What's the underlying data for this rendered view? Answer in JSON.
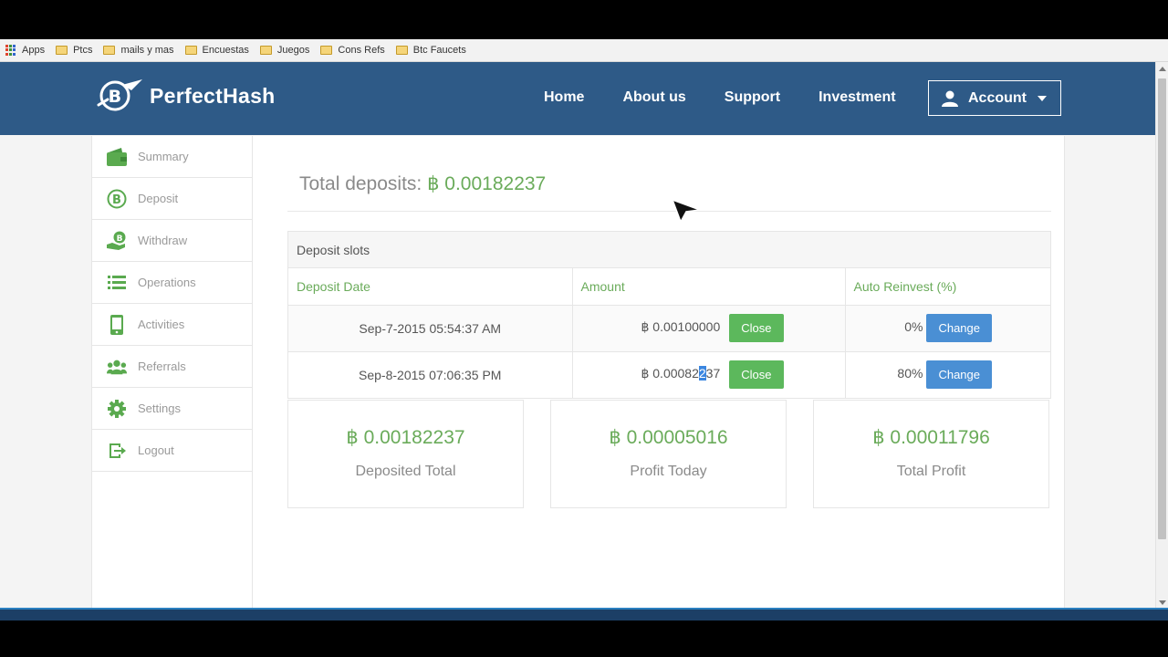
{
  "bookmarks": [
    {
      "label": "Apps",
      "icon": "apps-grid-icon"
    },
    {
      "label": "Ptcs",
      "icon": "folder-icon"
    },
    {
      "label": "mails y mas",
      "icon": "folder-icon"
    },
    {
      "label": "Encuestas",
      "icon": "folder-icon"
    },
    {
      "label": "Juegos",
      "icon": "folder-icon"
    },
    {
      "label": "Cons Refs",
      "icon": "folder-icon"
    },
    {
      "label": "Btc Faucets",
      "icon": "folder-icon"
    }
  ],
  "brand": {
    "name": "PerfectHash",
    "color": "#2e5a87"
  },
  "nav": {
    "home": "Home",
    "about": "About us",
    "support": "Support",
    "investment": "Investment",
    "account": "Account"
  },
  "sidebar": {
    "items": [
      {
        "label": "Summary",
        "icon": "wallet-icon"
      },
      {
        "label": "Deposit",
        "icon": "bitcoin-icon"
      },
      {
        "label": "Withdraw",
        "icon": "hand-coin-icon"
      },
      {
        "label": "Operations",
        "icon": "list-icon"
      },
      {
        "label": "Activities",
        "icon": "phone-icon"
      },
      {
        "label": "Referrals",
        "icon": "users-icon"
      },
      {
        "label": "Settings",
        "icon": "gear-icon"
      },
      {
        "label": "Logout",
        "icon": "logout-icon"
      }
    ]
  },
  "main": {
    "total_label": "Total deposits:",
    "total_value": "฿ 0.00182237",
    "slots_title": "Deposit slots",
    "columns": [
      "Deposit Date",
      "Amount",
      "Auto Reinvest (%)"
    ],
    "rows": [
      {
        "date": "Sep-7-2015 05:54:37 AM",
        "amount": "฿ 0.00100000",
        "close": "Close",
        "reinvest": "0%",
        "change": "Change"
      },
      {
        "date": "Sep-8-2015 07:06:35 PM",
        "amount_pre": "฿ 0.00082",
        "amount_sel": "2",
        "amount_post": "37",
        "close": "Close",
        "reinvest": "80%",
        "change": "Change"
      }
    ],
    "cards": [
      {
        "value": "฿ 0.00182237",
        "label": "Deposited Total"
      },
      {
        "value": "฿ 0.00005016",
        "label": "Profit Today"
      },
      {
        "value": "฿ 0.00011796",
        "label": "Total Profit"
      }
    ]
  },
  "colors": {
    "accent_green": "#6aab5a",
    "button_green": "#5cb85c",
    "button_blue": "#4a8fd4"
  }
}
